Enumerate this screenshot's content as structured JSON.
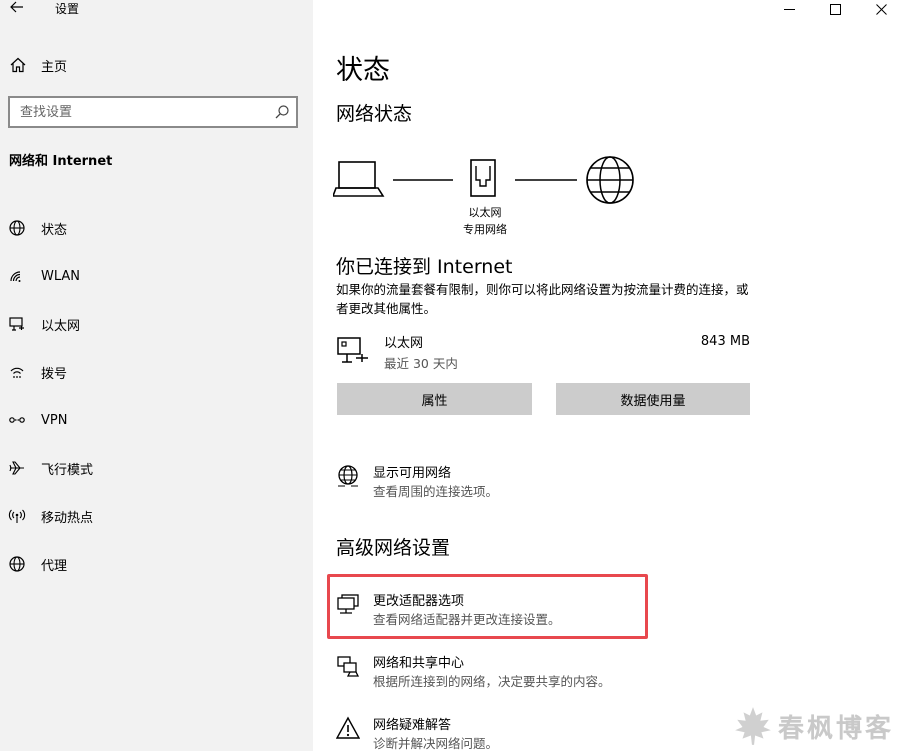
{
  "window": {
    "title": "设置"
  },
  "sidebar": {
    "home_label": "主页",
    "search_placeholder": "查找设置",
    "section_header": "网络和 Internet",
    "items": [
      {
        "label": "状态",
        "icon": "globe-icon"
      },
      {
        "label": "WLAN",
        "icon": "wifi-icon"
      },
      {
        "label": "以太网",
        "icon": "ethernet-icon"
      },
      {
        "label": "拨号",
        "icon": "dialup-icon"
      },
      {
        "label": "VPN",
        "icon": "vpn-icon"
      },
      {
        "label": "飞行模式",
        "icon": "airplane-icon"
      },
      {
        "label": "移动热点",
        "icon": "hotspot-icon"
      },
      {
        "label": "代理",
        "icon": "globe-icon"
      }
    ]
  },
  "main": {
    "title": "状态",
    "network_status_heading": "网络状态",
    "diagram_label_line1": "以太网",
    "diagram_label_line2": "专用网络",
    "connected_heading": "你已连接到 Internet",
    "connected_desc": "如果你的流量套餐有限制，则你可以将此网络设置为按流量计费的连接，或者更改其他属性。",
    "connection": {
      "name": "以太网",
      "period": "最近 30 天内",
      "usage": "843 MB"
    },
    "buttons": {
      "properties": "属性",
      "data_usage": "数据使用量"
    },
    "show_networks": {
      "title": "显示可用网络",
      "subtitle": "查看周围的连接选项。"
    },
    "advanced_heading": "高级网络设置",
    "advanced_links": [
      {
        "title": "更改适配器选项",
        "subtitle": "查看网络适配器并更改连接设置。"
      },
      {
        "title": "网络和共享中心",
        "subtitle": "根据所连接到的网络，决定要共享的内容。"
      },
      {
        "title": "网络疑难解答",
        "subtitle": "诊断并解决网络问题。"
      }
    ]
  },
  "watermark": {
    "text": "春枫博客"
  },
  "colors": {
    "sidebar_bg": "#f2f2f2",
    "button_bg": "#cccccc",
    "highlight": "#e8484e"
  }
}
